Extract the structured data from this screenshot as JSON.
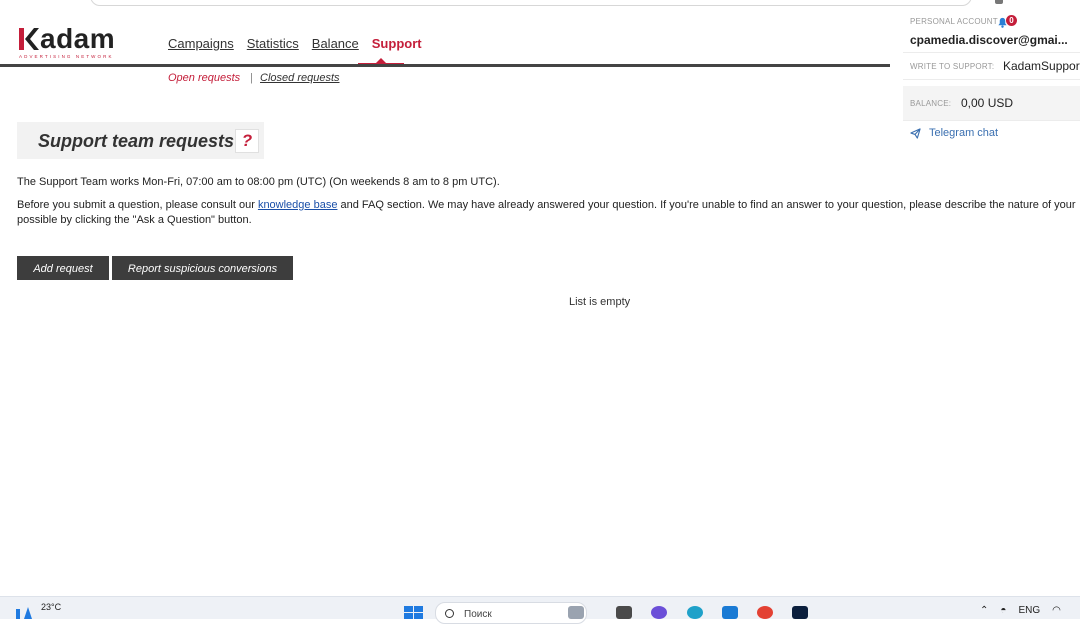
{
  "brand": {
    "name": "adam",
    "tagline": "ADVERTISING NETWORK"
  },
  "nav": {
    "items": [
      {
        "label": "Campaigns",
        "active": false
      },
      {
        "label": "Statistics",
        "active": false
      },
      {
        "label": "Balance",
        "active": false
      },
      {
        "label": "Support",
        "active": true
      }
    ]
  },
  "subnav": {
    "open": "Open requests",
    "separator": "|",
    "closed": "Closed requests"
  },
  "account": {
    "label": "PERSONAL ACCOUNT",
    "notifications": "0",
    "email": "cpamedia.discover@gmai...",
    "support_label": "WRITE TO SUPPORT:",
    "support_value": "KadamSupport",
    "balance_label": "BALANCE:",
    "balance_value": "0,00 USD",
    "telegram": "Telegram chat"
  },
  "page": {
    "title": "Support team requests",
    "help": "?",
    "hours": "The Support Team works Mon-Fri, 07:00 am to 08:00 pm (UTC) (On weekends 8 am to 8 pm UTC).",
    "consult_before": "Before you submit a question, please consult our",
    "consult_link": "knowledge base",
    "consult_after": "and FAQ section. We may have already answered your question. If you're unable to find an answer to your question, please describe the nature of your",
    "consult_line2": "possible by clicking the \"Ask a Question\" button.",
    "add_button": "Add request",
    "report_button": "Report suspicious conversions",
    "empty": "List is empty"
  },
  "taskbar": {
    "temperature": "23°C",
    "search": "Поиск",
    "language": "ENG"
  },
  "colors": {
    "accent": "#c41e3a",
    "button": "#3d3d3d",
    "link": "#1a4fa8"
  }
}
